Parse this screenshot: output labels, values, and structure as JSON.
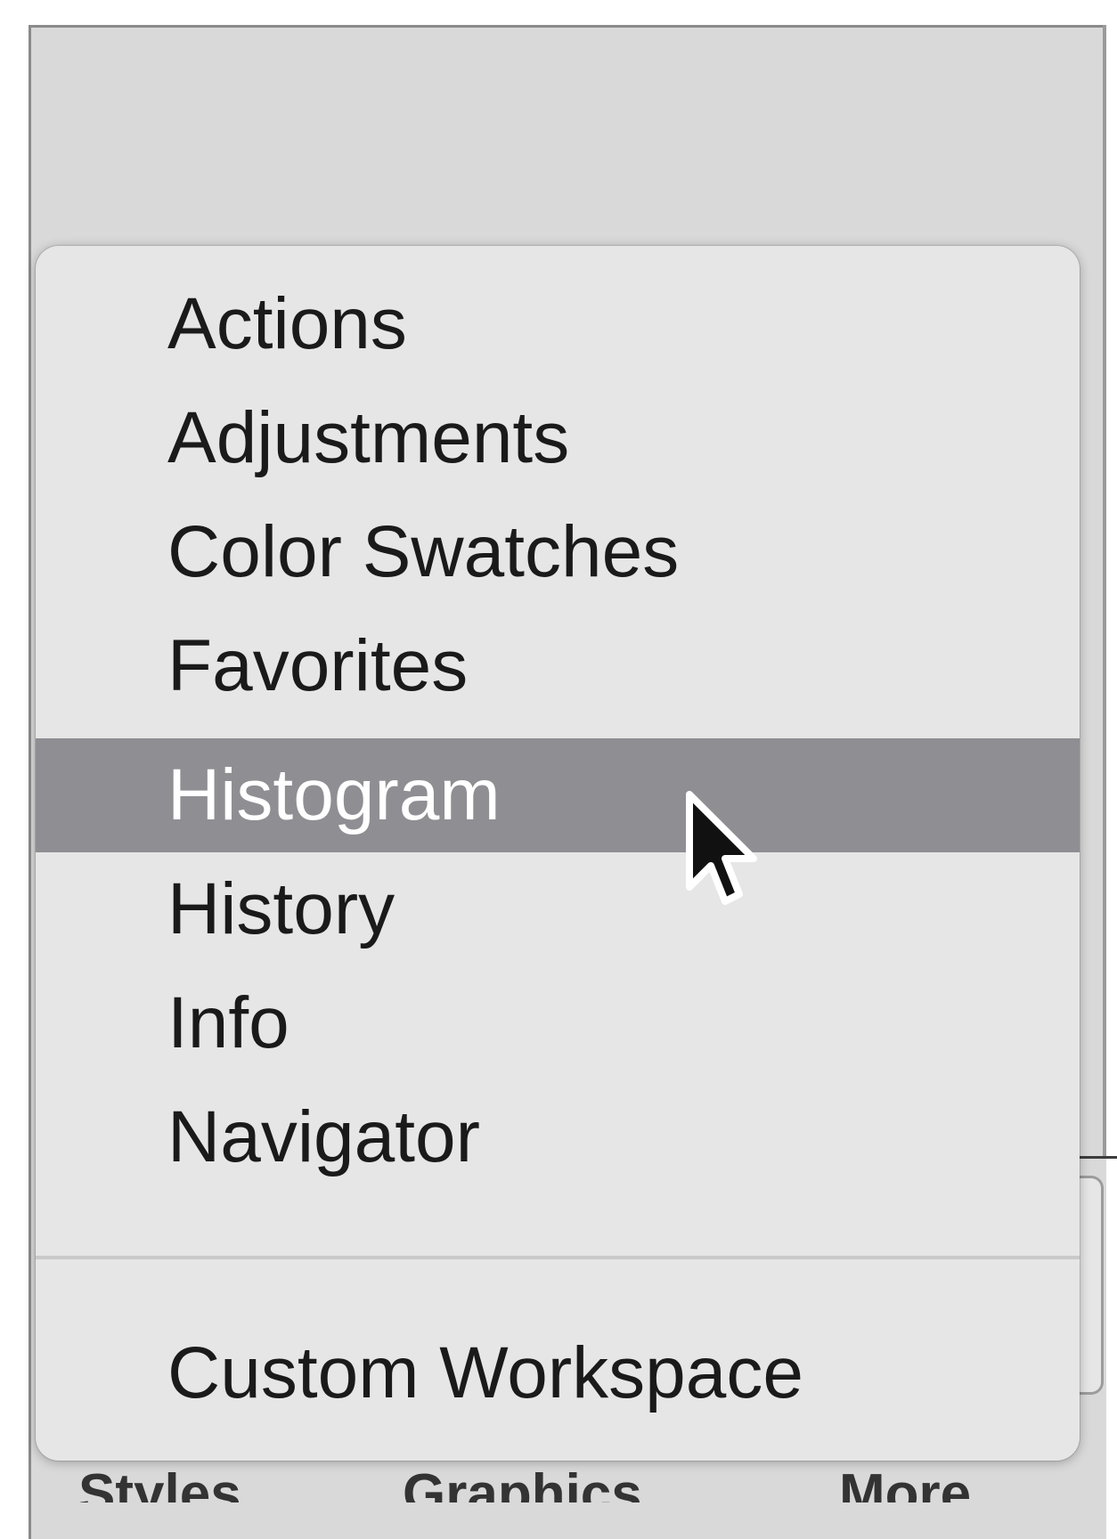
{
  "background_window": {
    "bottom_tabs": [
      "Styles",
      "Graphics",
      "More"
    ]
  },
  "menu": {
    "items": [
      {
        "label": "Actions",
        "highlighted": false
      },
      {
        "label": "Adjustments",
        "highlighted": false
      },
      {
        "label": "Color Swatches",
        "highlighted": false
      },
      {
        "label": "Favorites",
        "highlighted": false
      },
      {
        "label": "Histogram",
        "highlighted": true
      },
      {
        "label": "History",
        "highlighted": false
      },
      {
        "label": "Info",
        "highlighted": false
      },
      {
        "label": "Navigator",
        "highlighted": false
      }
    ],
    "footer_item": {
      "label": "Custom Workspace"
    }
  },
  "colors": {
    "menu_background": "#e6e6e6",
    "highlight": "#8e8e93",
    "window_background": "#d9d9d9"
  }
}
